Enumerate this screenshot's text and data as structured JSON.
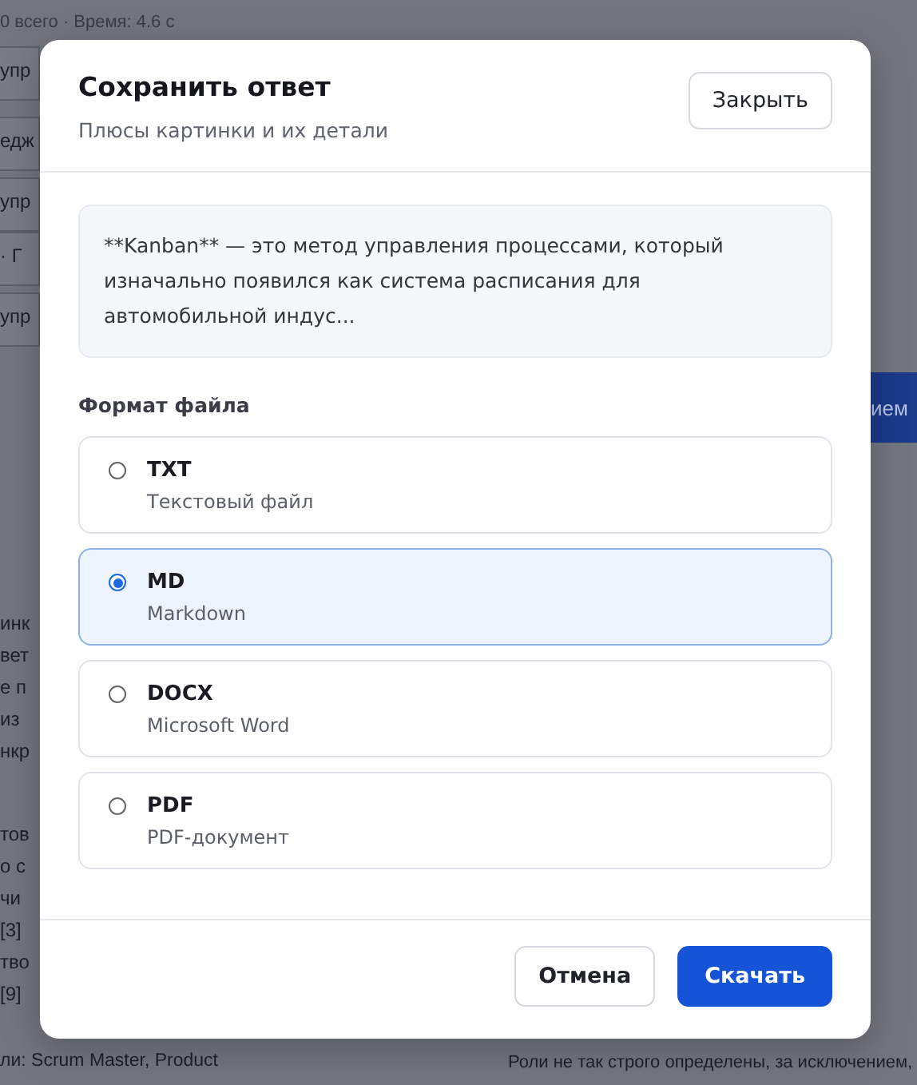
{
  "background": {
    "status": "0 всего · Время: 4.6 с",
    "left_fragments": [
      "упр",
      "едж",
      "упр",
      "· Г",
      "упр",
      "инк",
      "вет",
      "е п",
      "из",
      "нкр",
      "тов",
      "о с",
      "чи",
      "[3]",
      "тво",
      "[9]"
    ],
    "right_button": "ием",
    "bottom_left": "ли: Scrum Master, Product",
    "bottom_right": "Роли не так строго определены, за исключением,"
  },
  "dialog": {
    "title": "Сохранить ответ",
    "subtitle": "Плюсы картинки и их детали",
    "close_button": "Закрыть",
    "preview": "**Kanban** — это метод управления процессами, который изначально появился как система расписания для автомобильной индус...",
    "format_label": "Формат файла",
    "formats": [
      {
        "name": "TXT",
        "description": "Текстовый файл",
        "selected": false
      },
      {
        "name": "MD",
        "description": "Markdown",
        "selected": true
      },
      {
        "name": "DOCX",
        "description": "Microsoft Word",
        "selected": false
      },
      {
        "name": "PDF",
        "description": "PDF-документ",
        "selected": false
      }
    ],
    "cancel_button": "Отмена",
    "download_button": "Скачать"
  }
}
